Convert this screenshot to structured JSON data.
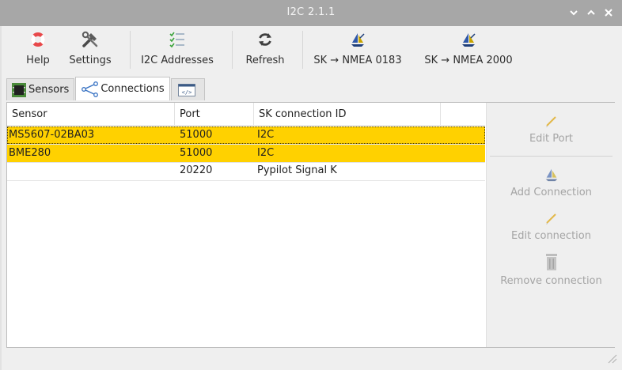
{
  "window": {
    "title": "I2C 2.1.1"
  },
  "toolbar": {
    "help": "Help",
    "settings": "Settings",
    "i2c_addresses": "I2C Addresses",
    "refresh": "Refresh",
    "sk_nmea0183": "SK → NMEA 0183",
    "sk_nmea2000": "SK → NMEA 2000"
  },
  "tabs": [
    {
      "label": "Sensors",
      "icon": "chip-icon"
    },
    {
      "label": "Connections",
      "icon": "share-icon"
    },
    {
      "label": "",
      "icon": "code-icon"
    }
  ],
  "table": {
    "columns": [
      "Sensor",
      "Port",
      "SK connection ID"
    ],
    "rows": [
      {
        "sensor": "MS5607-02BA03",
        "port": "51000",
        "sk_id": "I2C",
        "selected": true
      },
      {
        "sensor": "BME280",
        "port": "51000",
        "sk_id": "I2C",
        "selected": true
      },
      {
        "sensor": "",
        "port": "20220",
        "sk_id": "Pypilot Signal K",
        "selected": false
      }
    ]
  },
  "sidebar": {
    "edit_port": "Edit Port",
    "add_connection": "Add Connection",
    "edit_connection": "Edit connection",
    "remove_connection": "Remove connection"
  },
  "colors": {
    "selection": "#ffd100",
    "titlebar": "#a7a7a7",
    "disabled_text": "#a4a4a4",
    "accent_blue": "#3a74c4"
  }
}
